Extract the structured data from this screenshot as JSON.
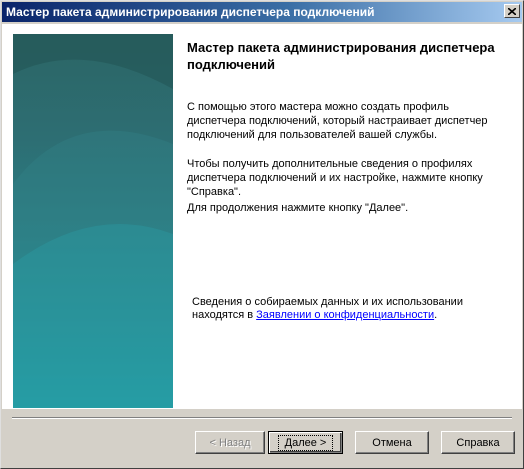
{
  "window": {
    "title": "Мастер пакета администрирования диспетчера подключений"
  },
  "content": {
    "heading": "Мастер пакета администрирования диспетчера подключений",
    "paragraph1": "С помощью этого мастера можно создать профиль диспетчера подключений, который настраивает диспетчер подключений для пользователей вашей службы.",
    "paragraph2": "Чтобы получить дополнительные сведения о профилях диспетчера подключений и их настройке, нажмите кнопку \"Справка\".",
    "paragraph3": "Для продолжения нажмите кнопку \"Далее\".",
    "privacy_text": "Сведения о собираемых данных и их использовании находятся в ",
    "privacy_link": "Заявлении о конфиденциальности",
    "privacy_suffix": "."
  },
  "buttons": {
    "back": "< Назад",
    "next": "Далее >",
    "cancel": "Отмена",
    "help": "Справка"
  },
  "colors": {
    "titlebar_start": "#0a246a",
    "titlebar_end": "#a6caf0",
    "panel_top": "#2c6565",
    "panel_bottom": "#1ba8b0",
    "link": "#0000ff"
  }
}
